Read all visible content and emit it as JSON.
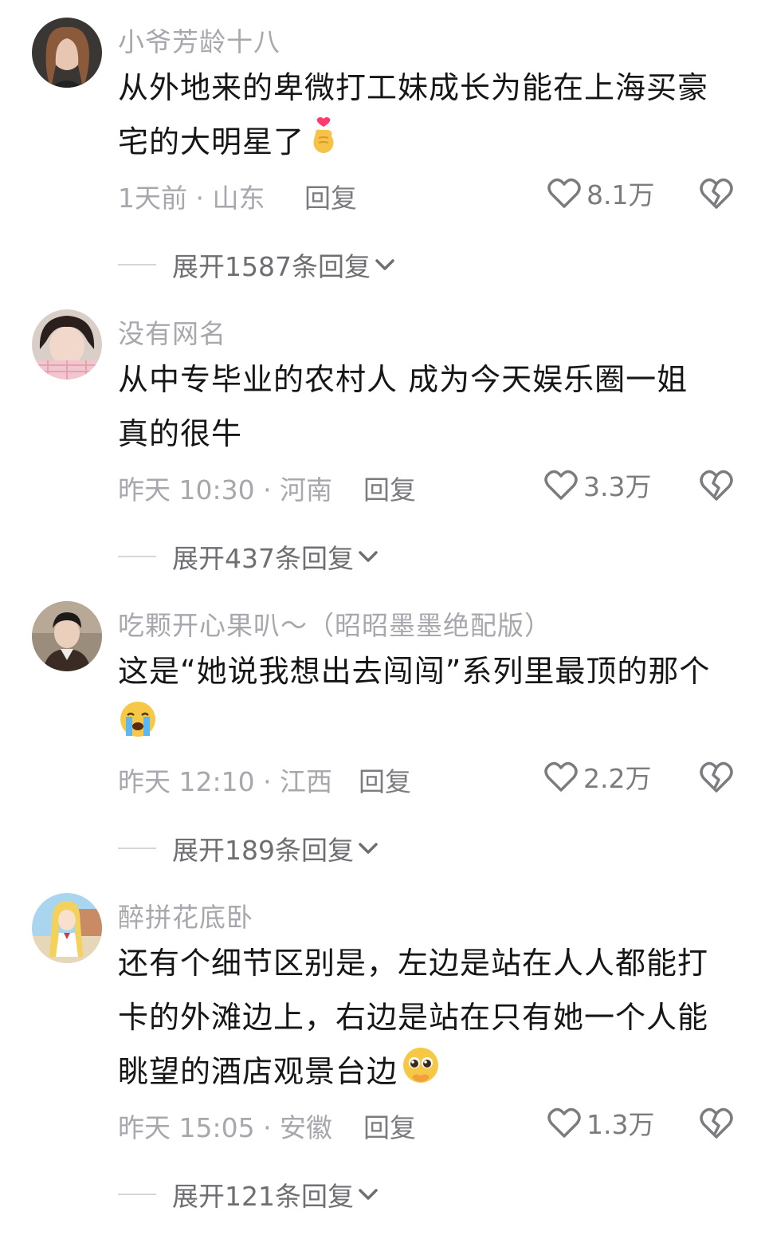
{
  "comments": [
    {
      "username": "小爷芳龄十八",
      "text_line1": "从外地来的卑微打工妹成长为能在上海买豪",
      "text_line2": "宅的大明星了",
      "emoji": "finger-heart-emoji",
      "meta": "1天前 · 山东",
      "reply_label": "回复",
      "likes": "8.1万",
      "expand_label": "展开1587条回复"
    },
    {
      "username": "没有网名",
      "text_line1": "从中专毕业的农村人 成为今天娱乐圈一姐",
      "text_line2": "真的很牛",
      "meta": "昨天 10:30 · 河南",
      "reply_label": "回复",
      "likes": "3.3万",
      "expand_label": "展开437条回复"
    },
    {
      "username": "吃颗开心果叭～（昭昭墨墨绝配版）",
      "text_line1": "这是“她说我想出去闯闯”系列里最顶的那个",
      "emoji": "loudly-crying-face-emoji",
      "meta": "昨天 12:10 · 江西",
      "reply_label": "回复",
      "likes": "2.2万",
      "expand_label": "展开189条回复"
    },
    {
      "username": "醉拼花底卧",
      "text_line1": "还有个细节区别是，左边是站在人人都能打",
      "text_line2": "卡的外滩边上，右边是站在只有她一个人能",
      "text_line3": "眺望的酒店观景台边",
      "emoji": "pleading-face-emoji",
      "meta": "昨天 15:05 · 安徽",
      "reply_label": "回复",
      "likes": "1.3万",
      "expand_label": "展开121条回复"
    }
  ],
  "icons": {
    "like": "heart-outline-icon",
    "dislike": "broken-heart-icon",
    "expand": "chevron-down-icon"
  },
  "colors": {
    "text": "#161616",
    "secondary": "#a7a7ad",
    "action": "#7b7b80"
  }
}
